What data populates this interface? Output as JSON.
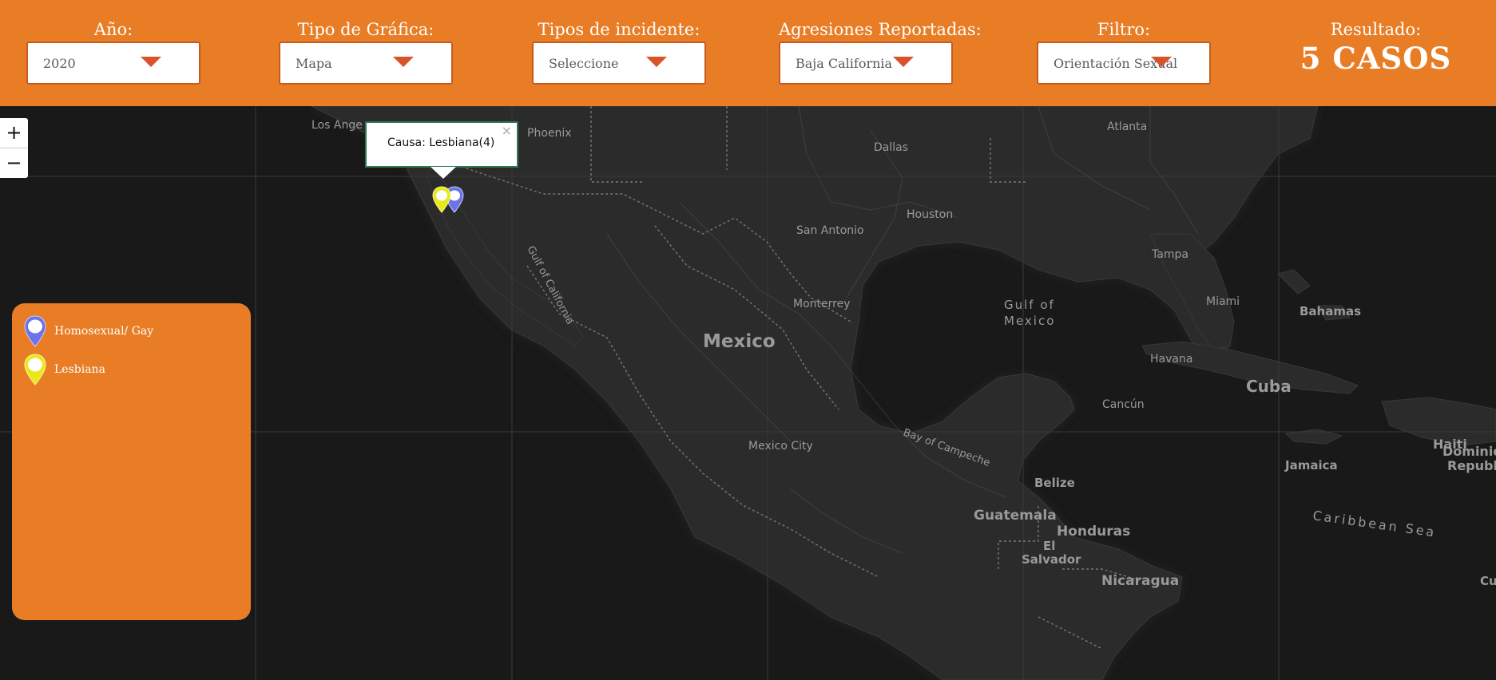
{
  "filters": [
    {
      "label": "Año:",
      "value": "2020"
    },
    {
      "label": "Tipo de Gráfica:",
      "value": "Mapa"
    },
    {
      "label": "Tipos de incidente:",
      "value": "Seleccione"
    },
    {
      "label": "Agresiones Reportadas:",
      "value": "Baja California"
    },
    {
      "label": "Filtro:",
      "value": "Orientación Sexual"
    }
  ],
  "result": {
    "label": "Resultado:",
    "value": "5 CASOS"
  },
  "colors": {
    "accent": "#e97d26",
    "map_bg": "#191919",
    "gay_marker": "#6b74e8",
    "lesbian_marker": "#e8e81a",
    "popup_border": "#2f7a4f"
  },
  "map": {
    "zoom_in": "+",
    "zoom_out": "−",
    "popup": {
      "text": "Causa: Lesbiana(4)",
      "close": "×"
    },
    "labels": {
      "los_angeles": "Los Ange",
      "phoenix": "Phoenix",
      "dallas": "Dallas",
      "atlanta": "Atlanta",
      "houston": "Houston",
      "san_antonio": "San Antonio",
      "tampa": "Tampa",
      "miami": "Miami",
      "bahamas": "Bahamas",
      "monterrey": "Monterrey",
      "gulf_of_mexico_1": "Gulf of",
      "gulf_of_mexico_2": "Mexico",
      "gulf_of_california": "Gulf of California",
      "mexico": "Mexico",
      "havana": "Havana",
      "cuba": "Cuba",
      "cancun": "Cancún",
      "bay_of_campeche": "Bay of Campeche",
      "mexico_city": "Mexico City",
      "belize": "Belize",
      "haiti": "Haiti",
      "dominican_1": "Dominica",
      "dominican_2": "Republi",
      "jamaica": "Jamaica",
      "guatemala": "Guatemala",
      "honduras": "Honduras",
      "el": "El",
      "salvador": "Salvador",
      "caribbean_sea": "Caribbean Sea",
      "nicaragua": "Nicaragua",
      "cu": "Cu"
    }
  },
  "legend": [
    {
      "label": "Homosexual/ Gay",
      "icon": "blue-pin-icon"
    },
    {
      "label": "Lesbiana",
      "icon": "yellow-pin-icon"
    }
  ]
}
